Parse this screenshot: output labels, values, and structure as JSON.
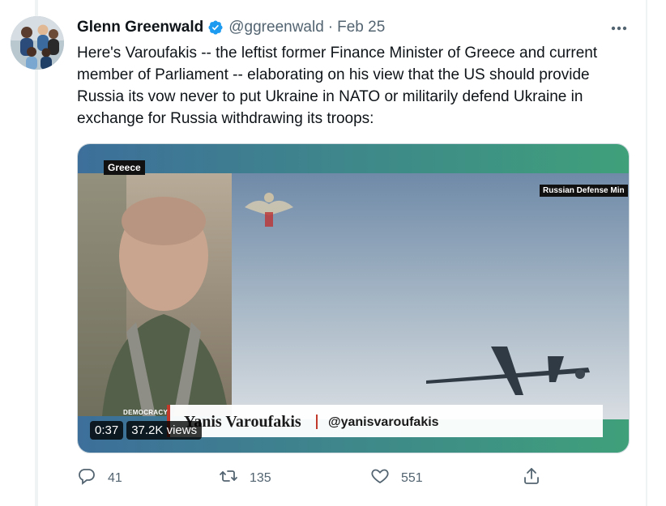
{
  "tweet": {
    "author": {
      "display_name": "Glenn Greenwald",
      "handle": "@ggreenwald",
      "verified": true
    },
    "separator": "·",
    "date": "Feb 25",
    "text": "Here's Varoufakis -- the leftist former Finance Minister of Greece and current member of Parliament -- elaborating on his view that the US should provide Russia its vow never to put Ukraine in NATO or militarily defend Ukraine in exchange for Russia withdrawing its troops:",
    "media": {
      "type": "video",
      "duration": "0:37",
      "views": "37.2K views",
      "overlay": {
        "country_tag": "Greece",
        "source_tag": "Russian Defense Min",
        "lower_third_name": "Yanis Varoufakis",
        "lower_third_handle": "@yanisvaroufakis",
        "network_tag": "DEMOCRACY"
      }
    },
    "actions": {
      "replies": "41",
      "retweets": "135",
      "likes": "551"
    }
  },
  "icons": {
    "verified": "verified-badge-icon",
    "more": "more-options-icon",
    "reply": "reply-icon",
    "retweet": "retweet-icon",
    "like": "heart-icon",
    "share": "share-icon"
  },
  "colors": {
    "verified_blue": "#1d9bf0",
    "secondary_text": "#536471",
    "primary_text": "#0f1419"
  }
}
